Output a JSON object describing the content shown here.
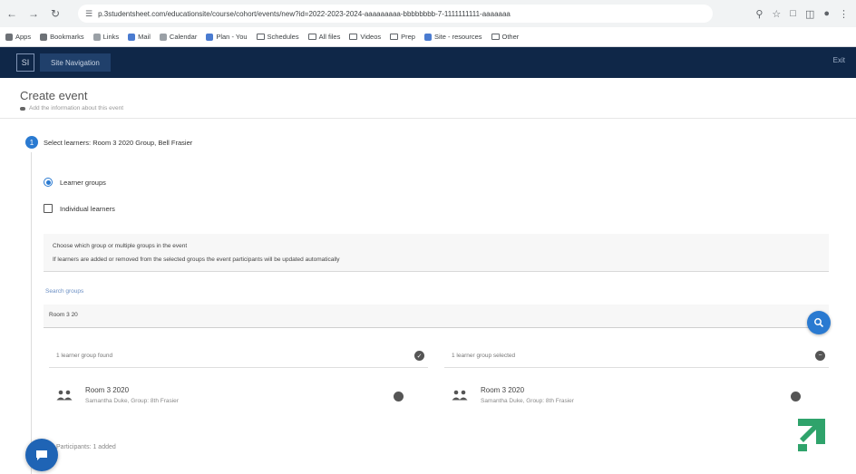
{
  "browser": {
    "address": "p.3studentsheet.com/educationsite/course/cohort/events/new?id=2022-2023-2024-aaaaaaaaa-bbbbbbbb-7-1111111111-aaaaaaa",
    "bookmarks": [
      {
        "label": "Apps",
        "icon": "apps-icon"
      },
      {
        "label": "Bookmarks",
        "icon": "star-icon"
      },
      {
        "label": "Links",
        "icon": "link-icon"
      },
      {
        "label": "Mail",
        "icon": "mail-icon"
      },
      {
        "label": "Calendar",
        "icon": "doc-icon"
      },
      {
        "label": "Plan - You",
        "icon": "doc-icon"
      },
      {
        "label": "Schedules",
        "icon": "folder-icon"
      },
      {
        "label": "All files",
        "icon": "folder-icon"
      },
      {
        "label": "Videos",
        "icon": "folder-icon"
      },
      {
        "label": "Prep",
        "icon": "folder-icon"
      },
      {
        "label": "Site - resources",
        "icon": "doc-icon"
      },
      {
        "label": "Other",
        "icon": "folder-icon"
      }
    ]
  },
  "appbar": {
    "logo": "SI",
    "title": "Site Navigation",
    "right": "Exit"
  },
  "page": {
    "title": "Create event",
    "subtitle": "Add the information about this event"
  },
  "step": {
    "number": "1",
    "text": "Select learners: Room 3 2020 Group, Bell Frasier"
  },
  "options": {
    "learner_groups": "Learner groups",
    "individual_learners": "Individual learners"
  },
  "info": {
    "line1": "Choose which group or multiple groups in the event",
    "line2": "If learners are added or removed from the selected groups the event participants will be updated automatically"
  },
  "search": {
    "label": "Search groups",
    "value": "Room 3 20"
  },
  "panels": {
    "left_header": "1 learner group found",
    "right_header": "1 learner group selected",
    "left_row": {
      "name": "Room 3 2020",
      "sub": "Samantha Duke, Group: 8th Frasier"
    },
    "right_row": {
      "name": "Room 3 2020",
      "sub": "Samantha Duke, Group: 8th Frasier"
    }
  },
  "footer": {
    "text": "Participants: 1 added"
  },
  "colors": {
    "navy": "#0f2748",
    "accent": "#2a7ad1",
    "brand_green": "#2fa36b"
  }
}
